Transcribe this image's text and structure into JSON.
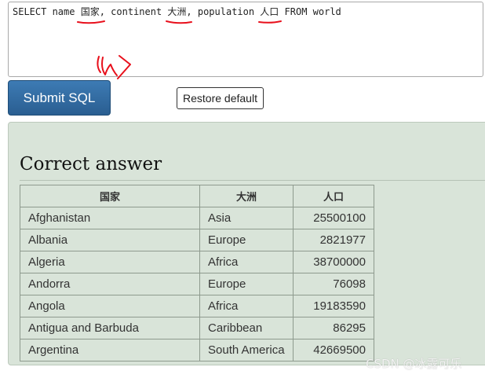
{
  "editor": {
    "sql": "SELECT name 国家, continent 大洲, population 人口 FROM world"
  },
  "buttons": {
    "submit_label": "Submit SQL",
    "restore_label": "Restore default"
  },
  "answer": {
    "title": "Correct answer",
    "columns": [
      "国家",
      "大洲",
      "人口"
    ],
    "rows": [
      {
        "name": "Afghanistan",
        "continent": "Asia",
        "population": "25500100"
      },
      {
        "name": "Albania",
        "continent": "Europe",
        "population": "2821977"
      },
      {
        "name": "Algeria",
        "continent": "Africa",
        "population": "38700000"
      },
      {
        "name": "Andorra",
        "continent": "Europe",
        "population": "76098"
      },
      {
        "name": "Angola",
        "continent": "Africa",
        "population": "19183590"
      },
      {
        "name": "Antigua and Barbuda",
        "continent": "Caribbean",
        "population": "86295"
      },
      {
        "name": "Argentina",
        "continent": "South America",
        "population": "42669500"
      }
    ]
  },
  "watermark": "CSDN @冰露可乐",
  "colors": {
    "annotation": "#e8101c",
    "submit_bg": "#2f6aa3",
    "panel_bg": "#d9e4d9"
  }
}
